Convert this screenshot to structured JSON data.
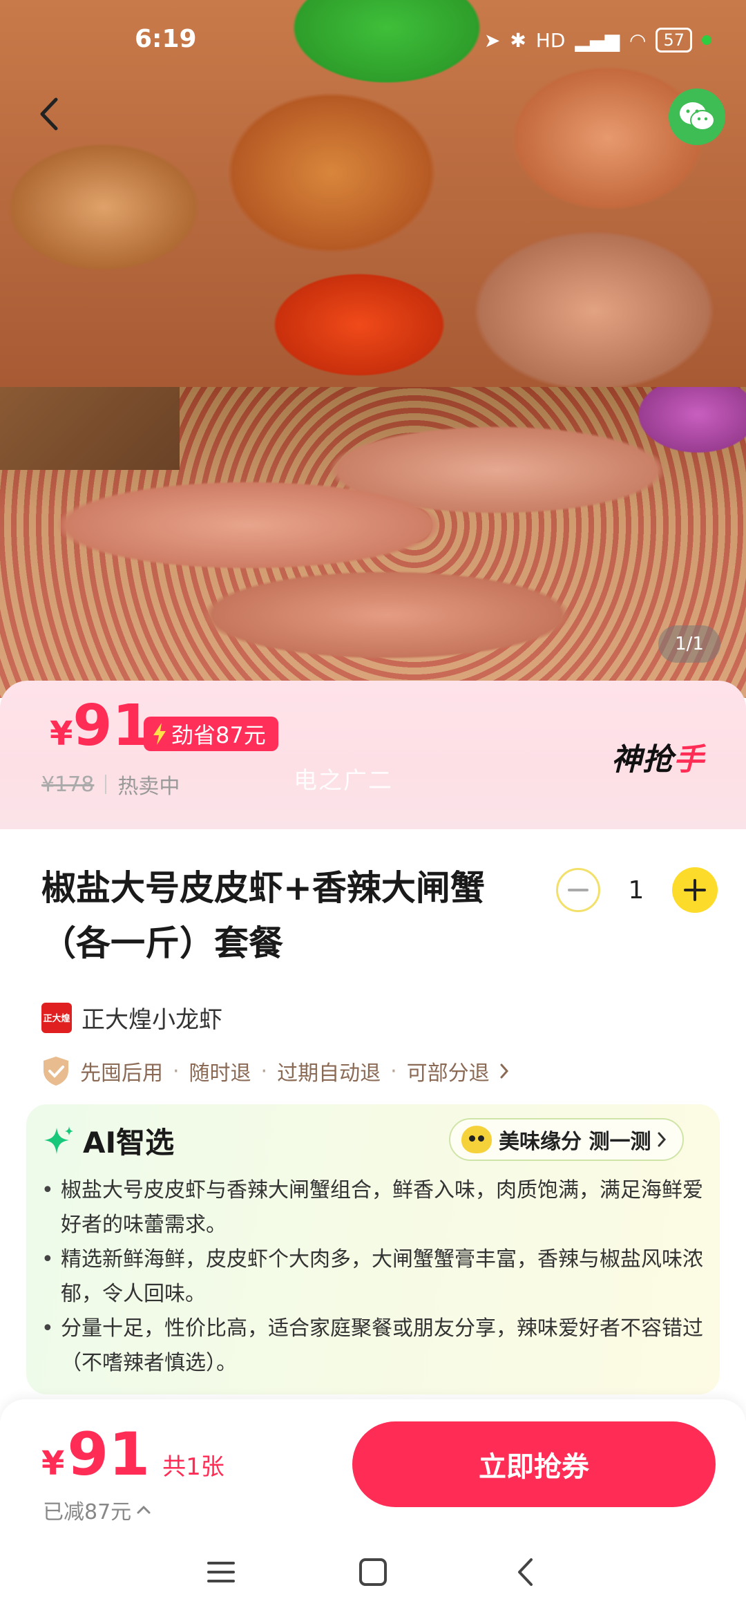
{
  "status_bar": {
    "time": "6:19",
    "network": "HD",
    "battery": "57"
  },
  "gallery": {
    "indicator": "1/1"
  },
  "price_card": {
    "currency": "¥",
    "price": "91",
    "save_badge": "劲省87元",
    "original_price": "¥178",
    "sale_status": "热卖中",
    "watermark": "电之广二",
    "brand_left": "神抢",
    "brand_accent": "手"
  },
  "product": {
    "title": "椒盐大号皮皮虾+香辣大闸蟹（各一斤）套餐",
    "quantity": "1"
  },
  "merchant": {
    "logo_text": "正大煌",
    "name": "正大煌小龙虾"
  },
  "guarantee": {
    "items": [
      "先囤后用",
      "随时退",
      "过期自动退",
      "可部分退"
    ]
  },
  "ai": {
    "title": "AI智选",
    "pill_label": "美味缘分 测一测",
    "points": [
      "椒盐大号皮皮虾与香辣大闸蟹组合，鲜香入味，肉质饱满，满足海鲜爱好者的味蕾需求。",
      "精选新鲜海鲜，皮皮虾个大肉多，大闸蟹蟹膏丰富，香辣与椒盐风味浓郁，令人回味。",
      "分量十足，性价比高，适合家庭聚餐或朋友分享，辣味爱好者不容错过（不嗜辣者慎选）。"
    ]
  },
  "bottom_bar": {
    "currency": "¥",
    "price": "91",
    "count": "共1张",
    "saved": "已减87元",
    "buy_label": "立即抢券"
  },
  "colors": {
    "accent": "#ff2d55",
    "yellow": "#fddb2b",
    "wechat": "#3dbd54"
  }
}
